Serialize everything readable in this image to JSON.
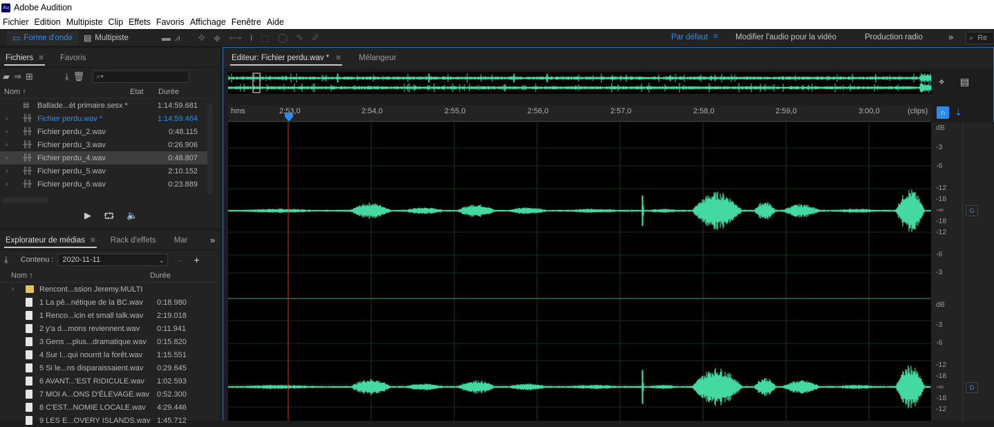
{
  "window": {
    "app_icon": "Au",
    "title": "Adobe Audition"
  },
  "menu": [
    "Fichier",
    "Edition",
    "Multipiste",
    "Clip",
    "Effets",
    "Favoris",
    "Affichage",
    "Fenêtre",
    "Aide"
  ],
  "toolbar": {
    "waveform_label": "Forme d'onde",
    "multitrack_label": "Multipiste",
    "workspaces": {
      "default": "Par défaut",
      "video": "Modifier l'audio pour la vidéo",
      "radio": "Production radio"
    },
    "more": "»",
    "search_text": "Re"
  },
  "files_panel": {
    "tabs": [
      "Fichiers",
      "Favoris"
    ],
    "search_placeholder": "",
    "columns": {
      "name": "Nom",
      "state": "Etat",
      "duration": "Durée"
    },
    "items": [
      {
        "name": "Ballade...ét primaire.sesx *",
        "duration": "1:14:59.681",
        "type": "session"
      },
      {
        "name": "Fichier perdu.wav *",
        "duration": "1:14:59.464",
        "type": "wave",
        "active": true
      },
      {
        "name": "Fichier perdu_2.wav",
        "duration": "0:48.115",
        "type": "wave"
      },
      {
        "name": "Fichier perdu_3.wav",
        "duration": "0:26.906",
        "type": "wave"
      },
      {
        "name": "Fichier perdu_4.wav",
        "duration": "0:48.807",
        "type": "wave",
        "selected": true
      },
      {
        "name": "Fichier perdu_5.wav",
        "duration": "2:10.152",
        "type": "wave"
      },
      {
        "name": "Fichier perdu_6.wav",
        "duration": "0:23.889",
        "type": "wave"
      }
    ]
  },
  "media_panel": {
    "tabs": [
      "Explorateur de médias",
      "Rack d'effets",
      "Mar"
    ],
    "content_label": "Contenu :",
    "content_value": "2020-11-11",
    "columns": {
      "name": "Nom",
      "duration": "Durée"
    },
    "items": [
      {
        "name": "Rencont...ssion Jeremy.MULTI",
        "duration": "",
        "folder": true
      },
      {
        "name": "1 La pê...nétique de la BC.wav",
        "duration": "0:18.980"
      },
      {
        "name": "1 Renco...icin et small talk.wav",
        "duration": "2:19.018"
      },
      {
        "name": "2 y'a d...mons reviennent.wav",
        "duration": "0:11.941"
      },
      {
        "name": "3 Gens ...plus...dramatique.wav",
        "duration": "0:15.820"
      },
      {
        "name": "4 Sur l...qui nourrit la forêt.wav",
        "duration": "1:15.551"
      },
      {
        "name": "5 Si le...ns disparaissaient.wav",
        "duration": "0:29.645"
      },
      {
        "name": "6 AVANT...'EST RIDICULE.wav",
        "duration": "1:02.593"
      },
      {
        "name": "7 MOI A...ONS D'ÉLEVAGE.wav",
        "duration": "0:52.300"
      },
      {
        "name": "8 C'EST...NOMIE LOCALE.wav",
        "duration": "4:29.446"
      },
      {
        "name": "9 LES E...OVERY ISLANDS.wav",
        "duration": "1:45.712"
      }
    ]
  },
  "editor": {
    "tabs": [
      "Editeur: Fichier perdu.wav *",
      "Mélangeur"
    ],
    "ruler": {
      "unit": "hms",
      "labels": [
        "2:53,0",
        "2:54,0",
        "2:55,0",
        "2:56,0",
        "2:57,0",
        "2:58,0",
        "2:59,0",
        "3:00,0"
      ],
      "end": "(clips)"
    },
    "db_top": [
      "dB",
      "-3",
      "-6",
      "-12",
      "-18",
      "-∞",
      "-18",
      "-12",
      "-6",
      "-3"
    ],
    "db_bottom": [
      "dB",
      "-3",
      "-6",
      "-12",
      "-18",
      "-∞",
      "-18",
      "-12"
    ],
    "channels": {
      "left": "G",
      "right": "D"
    },
    "playhead_time": "2:53,0",
    "colors": {
      "waveform": "#43d9a0",
      "playhead": "#e03030",
      "accent": "#2d8ceb"
    }
  }
}
